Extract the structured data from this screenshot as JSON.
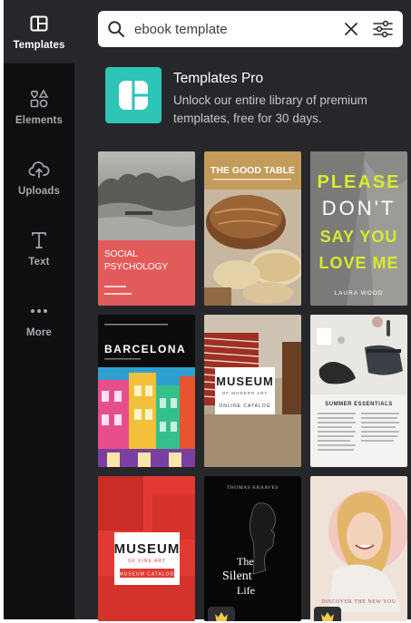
{
  "sidebar": {
    "items": [
      {
        "label": "Templates",
        "icon": "templates-icon",
        "active": true
      },
      {
        "label": "Elements",
        "icon": "elements-icon",
        "active": false
      },
      {
        "label": "Uploads",
        "icon": "upload-cloud-icon",
        "active": false
      },
      {
        "label": "Text",
        "icon": "text-icon",
        "active": false
      },
      {
        "label": "More",
        "icon": "more-dots-icon",
        "active": false
      }
    ]
  },
  "search": {
    "value": "ebook template",
    "icon": "search-icon",
    "clear_icon": "close-icon",
    "filter_icon": "filter-sliders-icon"
  },
  "promo": {
    "title": "Templates Pro",
    "description": "Unlock our entire library of premium templates, free for 30 days.",
    "accent": "#2ec4b6"
  },
  "templates": [
    {
      "title_line1": "SOCIAL",
      "title_line2": "PSYCHOLOGY",
      "accent": "#e25b5b"
    },
    {
      "title": "THE GOOD TABLE"
    },
    {
      "title_lines": [
        "PLEASE",
        "DON'T",
        "SAY YOU",
        "LOVE ME"
      ],
      "author": "LAURA WOOD",
      "accent": "#d7ec2c"
    },
    {
      "title": "BARCELONA"
    },
    {
      "title": "MUSEUM",
      "subtitle": "OF MODERN ART",
      "caption": "ONLINE CATALOG"
    },
    {
      "title": "SUMMER ESSENTIALS"
    },
    {
      "title": "MUSEUM",
      "subtitle": "OF FINE ART",
      "caption": "MUSEUM CATALOG",
      "accent": "#e23a32"
    },
    {
      "author": "THOMAS KRAAVES",
      "title_line1": "The",
      "title_line2": "Silent",
      "title_line3": "Life"
    },
    {
      "title": "DISCOVER THE NEW YOU"
    }
  ],
  "colors": {
    "rail_bg": "#0e0f11",
    "panel_bg": "#25272a",
    "crown": "#f2c94c"
  }
}
